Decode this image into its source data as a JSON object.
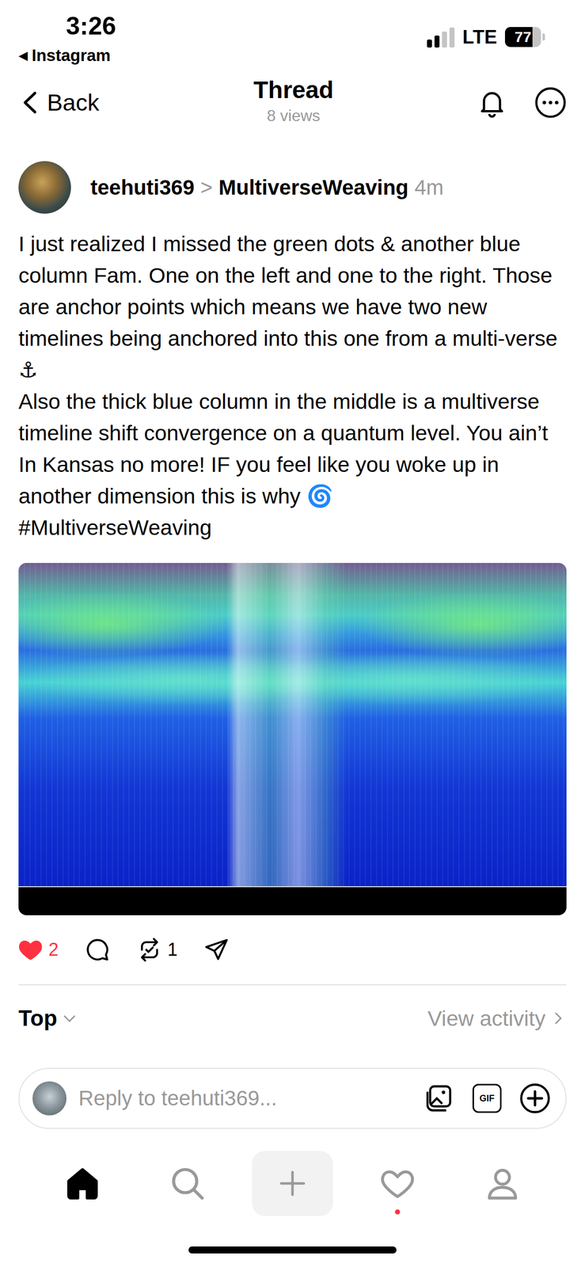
{
  "status_bar": {
    "time": "3:26",
    "back_app_icon": "◀",
    "back_app": "Instagram",
    "network": "LTE",
    "battery": "77",
    "battery_level": 0.77,
    "signal_level": 0.5
  },
  "nav": {
    "back": "Back",
    "title": "Thread",
    "subtitle": "8 views"
  },
  "post": {
    "author": "teehuti369",
    "separator": ">",
    "community": "MultiverseWeaving",
    "time": "4m",
    "paragraphs": [
      "I just realized I missed the green dots & another blue column Fam. One on the left and one to the right. Those are anchor points which means we have two new timelines being anchored into this one from a multi-verse ⚓",
      "Also the thick blue column in the middle is a multiverse timeline shift convergence on a quantum level. You ain’t In Kansas no more! IF you feel like you woke up in another dimension this is why 🌀",
      "#MultiverseWeaving"
    ],
    "likes": "2",
    "liked": true,
    "reposts": "1"
  },
  "sort": {
    "label": "Top",
    "activity": "View activity"
  },
  "reply": {
    "placeholder": "Reply to teehuti369...",
    "gif": "GIF"
  },
  "tab_bar": {
    "items": [
      {
        "kind": "home",
        "selected": true,
        "badge": false
      },
      {
        "kind": "search",
        "selected": false,
        "badge": false
      },
      {
        "kind": "create",
        "selected": false,
        "badge": false
      },
      {
        "kind": "activity",
        "selected": false,
        "badge": true
      },
      {
        "kind": "profile",
        "selected": false,
        "badge": false
      }
    ]
  }
}
